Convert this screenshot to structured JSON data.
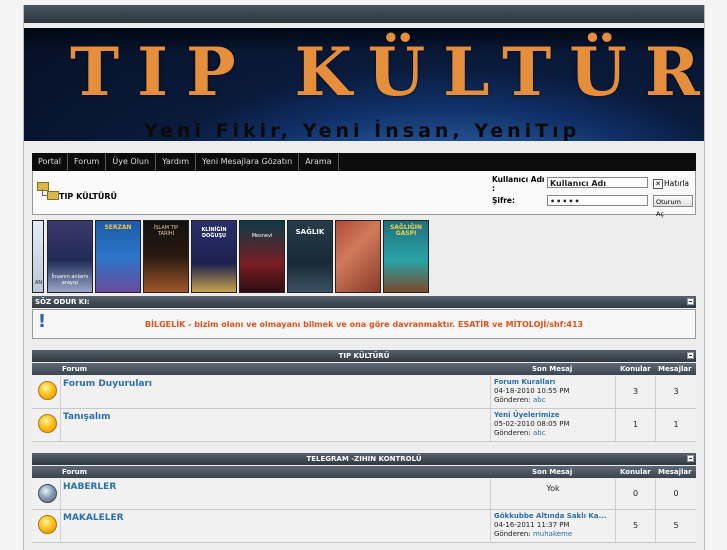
{
  "banner": {
    "title": "TIP KÜLTÜRÜ",
    "subtitle": "Yeni Fikir, Yeni İnsan, YeniTıp"
  },
  "nav": [
    "Portal",
    "Forum",
    "Üye Olun",
    "Yardım",
    "Yeni Mesajlara Gözatın",
    "Arama"
  ],
  "breadcrumb": {
    "title": "TIP KÜLTÜRÜ"
  },
  "login": {
    "username_label": "Kullanıcı Adı",
    "username_colon": ":",
    "username_value": "Kullanıcı Adı",
    "password_label": "Şifre:",
    "password_value": "•••••",
    "remember_label": "Hatırla",
    "remember_checked": "✕",
    "submit_label": "Oturum Aç"
  },
  "books": [
    {
      "title": "AN"
    },
    {
      "title": "İnsanın anlamı arayışı"
    },
    {
      "title": "SERZAN"
    },
    {
      "title": "İSLAM TIP TARİHİ"
    },
    {
      "title": "KLİNİĞİN DOĞUŞU"
    },
    {
      "title": "Mesnevi"
    },
    {
      "title": "SAĞLIK"
    },
    {
      "title": ""
    },
    {
      "title": "SAĞLIĞIN GASPI"
    }
  ],
  "quote": {
    "header": "SÖZ ODUR KI:",
    "text": "BİLGELİK - bizim olanı ve olmayanı bilmek ve ona göre davranmaktır. ESATİR ve MİTOLOJİ/shf:413"
  },
  "sections": [
    {
      "title": "TIP KÜLTÜRÜ",
      "columns": {
        "forum": "Forum",
        "last": "Son Mesaj",
        "topics": "Konular",
        "posts": "Mesajlar"
      },
      "rows": [
        {
          "name": "Forum Duyuruları",
          "status": "on",
          "last_title": "Forum Kuralları",
          "last_date": "04-18-2010 10:55 PM",
          "sender_label": "Gönderen:",
          "last_user": "abc",
          "topics": "3",
          "posts": "3"
        },
        {
          "name": "Tanışalım",
          "status": "on",
          "last_title": "Yeni Üyelerimize",
          "last_date": "05-02-2010 08:05 PM",
          "sender_label": "Gönderen:",
          "last_user": "abc",
          "topics": "1",
          "posts": "1"
        }
      ]
    },
    {
      "title": "TELEGRAM -ZIHIN KONTROLÜ",
      "columns": {
        "forum": "Forum",
        "last": "Son Mesaj",
        "topics": "Konular",
        "posts": "Mesajlar"
      },
      "rows": [
        {
          "name": "HABERLER",
          "status": "off",
          "last_none": "Yok",
          "topics": "0",
          "posts": "0"
        },
        {
          "name": "MAKALELER",
          "status": "on",
          "last_title": "Gökkubbe Altında Saklı Ka...",
          "last_date": "04-16-2011 11:37 PM",
          "sender_label": "Gönderen:",
          "last_user": "muhakeme",
          "topics": "5",
          "posts": "5"
        }
      ]
    }
  ]
}
